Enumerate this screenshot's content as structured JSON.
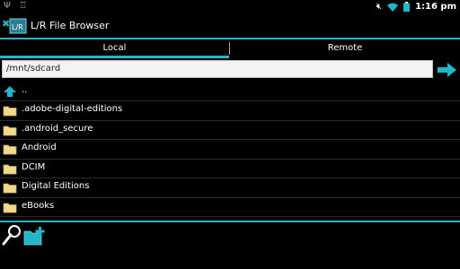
{
  "status": {
    "time": "1:16 pm",
    "left_icons": [
      "usb-icon",
      "android-debug-icon"
    ],
    "right_icons": [
      "mute-icon",
      "wifi-icon",
      "battery-icon"
    ]
  },
  "app": {
    "title": "L/R File Browser",
    "icon": "lr-logo-icon"
  },
  "tabs": [
    {
      "label": "Local",
      "selected": true
    },
    {
      "label": "Remote",
      "selected": false
    }
  ],
  "path": {
    "value": "/mnt/sdcard"
  },
  "files": [
    {
      "name": "..",
      "icon": "up-arrow-icon"
    },
    {
      "name": ".adobe-digital-editions",
      "icon": "folder-icon"
    },
    {
      "name": ".android_secure",
      "icon": "folder-icon"
    },
    {
      "name": "Android",
      "icon": "folder-icon"
    },
    {
      "name": "DCIM",
      "icon": "folder-icon"
    },
    {
      "name": "Digital Editions",
      "icon": "folder-icon"
    },
    {
      "name": "eBooks",
      "icon": "folder-icon"
    }
  ],
  "toolbar": {
    "search_icon": "search-icon",
    "new_folder_icon": "new-folder-icon"
  },
  "colors": {
    "accent": "#21b6c9",
    "background": "#000000"
  }
}
